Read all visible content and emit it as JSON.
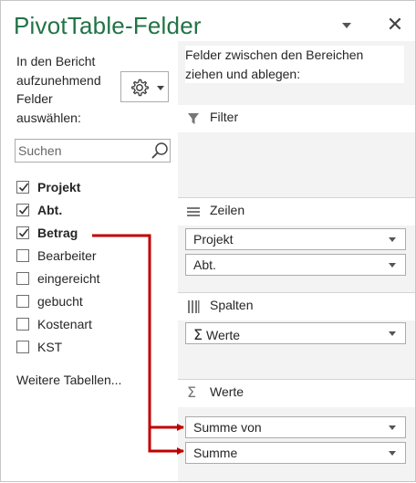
{
  "pane": {
    "title": "PivotTable-Felder",
    "close_symbol": "✕",
    "instruction": "In den Bericht aufzunehmend Felder auswählen:",
    "search_placeholder": "Suchen",
    "more_tables": "Weitere Tabellen...",
    "drag_instruction": "Felder zwischen den Bereichen ziehen und ablegen:"
  },
  "fields": [
    {
      "label": "Projekt",
      "checked": true,
      "bold": true
    },
    {
      "label": "Abt.",
      "checked": true,
      "bold": true
    },
    {
      "label": "Betrag",
      "checked": true,
      "bold": true
    },
    {
      "label": "Bearbeiter",
      "checked": false,
      "bold": false
    },
    {
      "label": "eingereicht",
      "checked": false,
      "bold": false
    },
    {
      "label": "gebucht",
      "checked": false,
      "bold": false
    },
    {
      "label": "Kostenart",
      "checked": false,
      "bold": false
    },
    {
      "label": "KST",
      "checked": false,
      "bold": false
    }
  ],
  "areas": {
    "filter": {
      "label": "Filter",
      "icon": "filter-icon"
    },
    "rows": {
      "label": "Zeilen",
      "icon": "rows-icon",
      "items": [
        "Projekt",
        "Abt."
      ]
    },
    "columns": {
      "label": "Spalten",
      "icon": "columns-icon",
      "items": [
        "Werte"
      ]
    },
    "values": {
      "label": "Werte",
      "icon": "sigma-icon",
      "items": [
        "Summe von",
        "Summe"
      ]
    }
  },
  "colors": {
    "title": "#217346",
    "arrow": "#c00000",
    "area_background": "#f3f3f3"
  }
}
